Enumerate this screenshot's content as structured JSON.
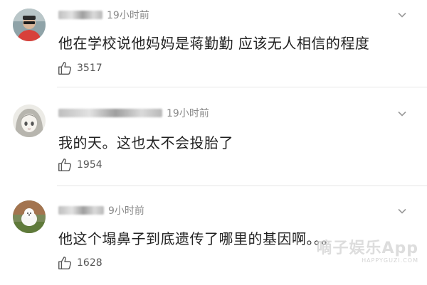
{
  "comments": [
    {
      "time": "19小时前",
      "text": "他在学校说他妈妈是蒋勤勤 应该无人相信的程度",
      "likes": "3517",
      "avatar": "avatar-person-icon"
    },
    {
      "time": "19小时前",
      "text": "我的天。这也太不会投胎了",
      "likes": "1954",
      "avatar": "avatar-anime-girl-icon"
    },
    {
      "time": "9小时前",
      "text": "他这个塌鼻子到底遗传了哪里的基因啊。。。",
      "likes": "1628",
      "avatar": "avatar-dog-icon"
    }
  ],
  "watermark": {
    "main": "嘀子娱乐App",
    "sub": "HAPPYGUZI.COM"
  },
  "icons": {
    "like": "thumbs-up-icon",
    "more": "chevron-down-icon"
  },
  "colors": {
    "text": "#222222",
    "meta": "#8a8a8a",
    "divider": "#e6e6e6"
  }
}
